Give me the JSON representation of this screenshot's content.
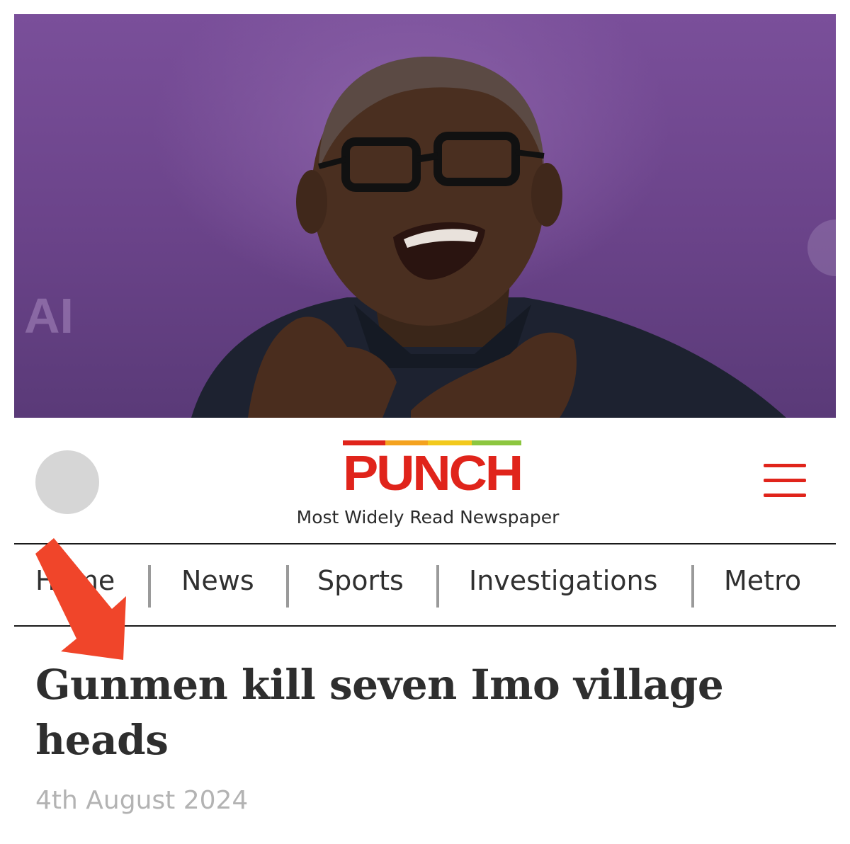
{
  "hero": {
    "image_icon": "portrait-photo"
  },
  "header": {
    "avatar_icon": "user-avatar-icon",
    "logo_text": "PUNCH",
    "tagline": "Most Widely Read Newspaper",
    "menu_icon": "hamburger-menu-icon",
    "accent_color": "#e0241b"
  },
  "nav": {
    "items": [
      {
        "label": "Home"
      },
      {
        "label": "News"
      },
      {
        "label": "Sports"
      },
      {
        "label": "Investigations"
      },
      {
        "label": "Metro"
      }
    ]
  },
  "annotation": {
    "arrow_icon": "red-arrow-icon",
    "arrow_color": "#f0452a"
  },
  "article": {
    "headline": "Gunmen kill seven Imo village heads",
    "date": "4th August 2024"
  }
}
